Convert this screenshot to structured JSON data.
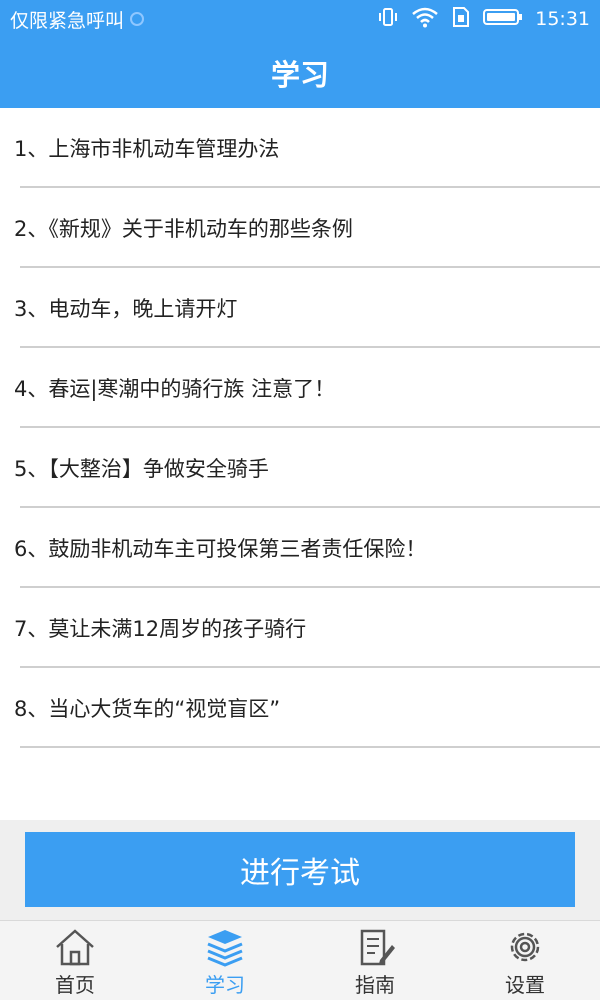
{
  "status_bar": {
    "left_text": "仅限紧急呼叫",
    "time": "15:31"
  },
  "header": {
    "title": "学习"
  },
  "articles": [
    {
      "label": "1、上海市非机动车管理办法"
    },
    {
      "label": "2、《新规》关于非机动车的那些条例"
    },
    {
      "label": "3、电动车，晚上请开灯"
    },
    {
      "label": "4、春运|寒潮中的骑行族 注意了！"
    },
    {
      "label": "5、【大整治】争做安全骑手"
    },
    {
      "label": "6、鼓励非机动车主可投保第三者责任保险！"
    },
    {
      "label": "7、莫让未满12周岁的孩子骑行"
    },
    {
      "label": "8、当心大货车的“视觉盲区”"
    }
  ],
  "exam_button": {
    "label": "进行考试"
  },
  "tab_bar": {
    "active": "学习",
    "tabs": [
      {
        "label": "首页",
        "icon": "home-icon"
      },
      {
        "label": "学习",
        "icon": "books-icon"
      },
      {
        "label": "指南",
        "icon": "guide-icon"
      },
      {
        "label": "设置",
        "icon": "gear-icon"
      }
    ]
  },
  "colors": {
    "accent": "#3b9ef2",
    "divider": "#cfcfcf",
    "tab_bar_bg": "#f4f4f4"
  }
}
